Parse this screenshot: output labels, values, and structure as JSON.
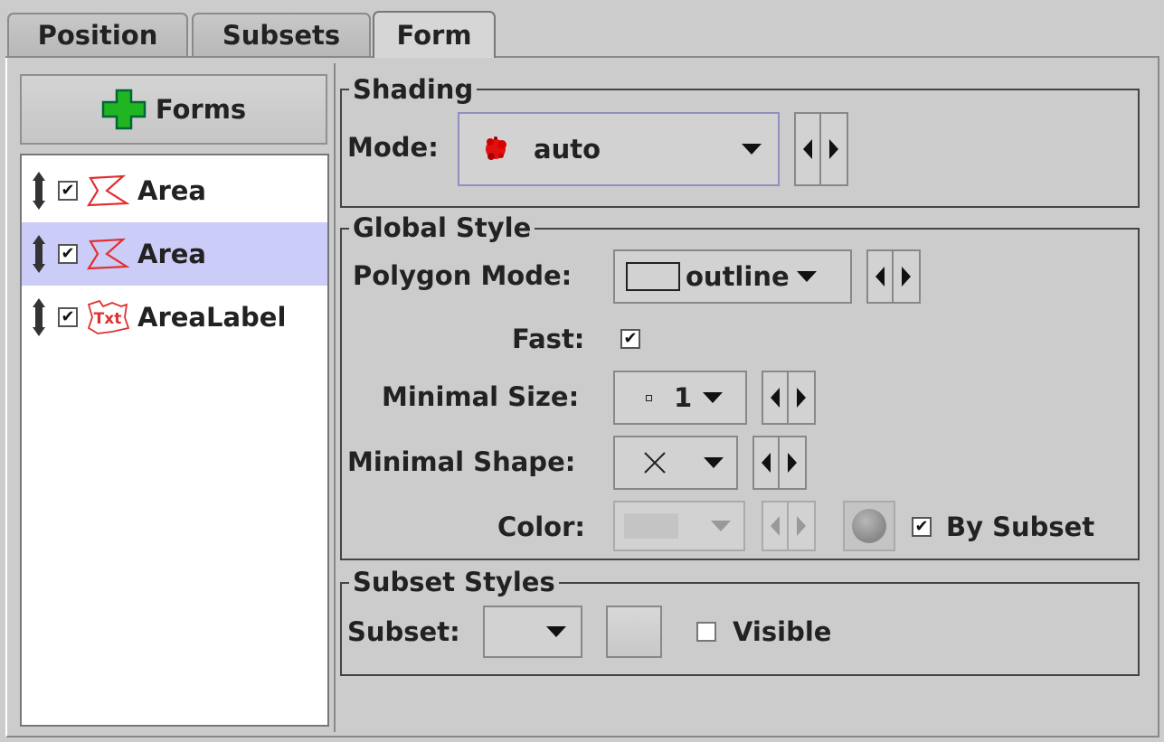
{
  "tabs": [
    {
      "label": "Position",
      "active": false
    },
    {
      "label": "Subsets",
      "active": false
    },
    {
      "label": "Form",
      "active": true
    }
  ],
  "forms_button": {
    "label": "Forms",
    "icon": "plus-icon",
    "icon_color": "#22aa22"
  },
  "layers": [
    {
      "label": "Area",
      "checked": true,
      "selected": false,
      "icon": "area-form-icon"
    },
    {
      "label": "Area",
      "checked": true,
      "selected": true,
      "icon": "area-form-icon"
    },
    {
      "label": "AreaLabel",
      "checked": true,
      "selected": false,
      "icon": "text-label-icon",
      "icon_text": "Txt"
    }
  ],
  "shading": {
    "title": "Shading",
    "mode_label": "Mode:",
    "mode_value": "auto",
    "mode_icon": "red-blob-icon"
  },
  "global_style": {
    "title": "Global Style",
    "polygon_mode_label": "Polygon Mode:",
    "polygon_mode_value": "outline",
    "fast_label": "Fast:",
    "fast_checked": true,
    "min_size_label": "Minimal Size:",
    "min_size_value": "1",
    "min_shape_label": "Minimal Shape:",
    "min_shape_value": "cross",
    "color_label": "Color:",
    "by_subset_label": "By Subset",
    "by_subset_checked": true
  },
  "subset_styles": {
    "title": "Subset Styles",
    "subset_label": "Subset:",
    "visible_label": "Visible",
    "visible_checked": false
  },
  "colors": {
    "selection": "#ccccf8",
    "form_icon": "#e03030",
    "panel": "#cccccc"
  }
}
